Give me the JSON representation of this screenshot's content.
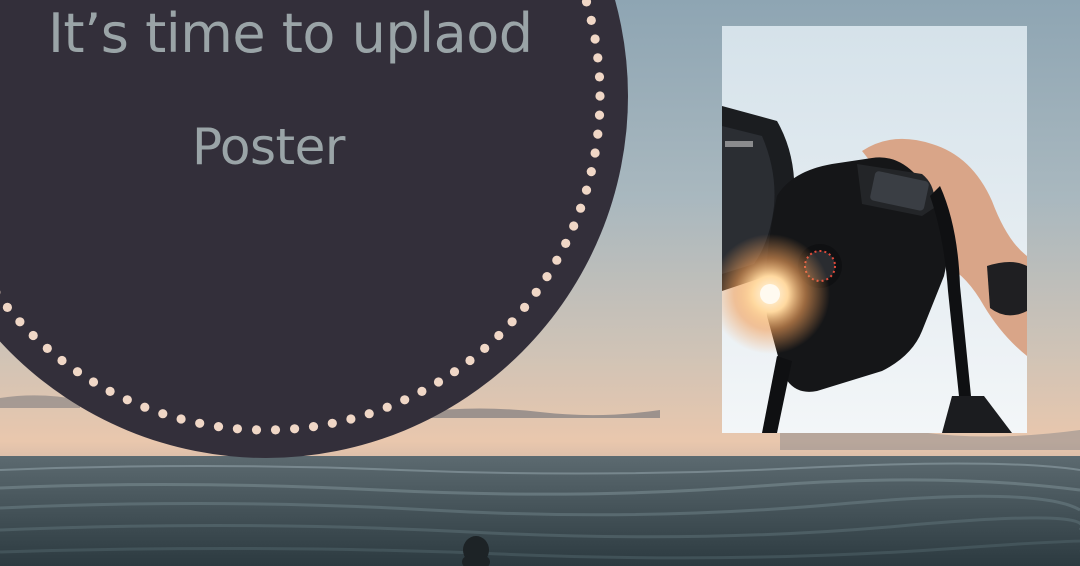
{
  "poster": {
    "title_line1": "It’s time to uplaod",
    "title_line2": "Poster"
  },
  "colors": {
    "circle_fill": "#332f3a",
    "dot_color": "#f0d7c6",
    "title_text": "#9aa4a7",
    "sky_top": "#8fa6b4",
    "sky_horizon": "#e7c9b0",
    "sea": "#3b4a50"
  },
  "icons": {
    "camera": "camera-illustration"
  }
}
